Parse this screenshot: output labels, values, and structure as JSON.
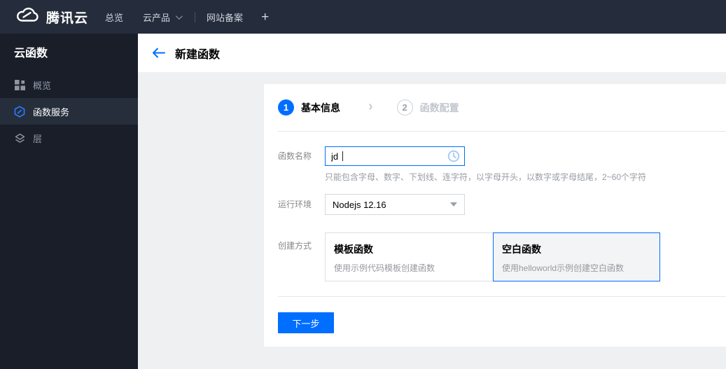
{
  "topbar": {
    "brand": "腾讯云",
    "nav": [
      {
        "label": "总览",
        "has_caret": false
      },
      {
        "label": "云产品",
        "has_caret": true
      },
      {
        "label": "网站备案",
        "has_caret": false
      }
    ],
    "plus": "+"
  },
  "sidebar": {
    "title": "云函数",
    "items": [
      {
        "label": "概览",
        "icon": "grid-icon",
        "active": false
      },
      {
        "label": "函数服务",
        "icon": "scf-hexagon-icon",
        "active": true
      },
      {
        "label": "层",
        "icon": "layers-icon",
        "active": false
      }
    ]
  },
  "header": {
    "title": "新建函数",
    "back_icon": "arrow-left-icon"
  },
  "wizard": {
    "steps": [
      {
        "number": "1",
        "label": "基本信息",
        "active": true
      },
      {
        "number": "2",
        "label": "函数配置",
        "active": false
      }
    ],
    "form": {
      "name": {
        "label": "函数名称",
        "value": "jd",
        "history_icon": "clock-icon",
        "helper": "只能包含字母、数字、下划线、连字符，以字母开头，以数字或字母结尾，2~60个字符"
      },
      "runtime": {
        "label": "运行环境",
        "value": "Nodejs 12.16"
      },
      "method": {
        "label": "创建方式",
        "options": [
          {
            "title": "模板函数",
            "desc": "使用示例代码模板创建函数",
            "selected": false
          },
          {
            "title": "空白函数",
            "desc": "使用helloworld示例创建空白函数",
            "selected": true
          }
        ]
      }
    },
    "next_button": "下一步"
  },
  "colors": {
    "accent": "#006eff",
    "topbar_bg": "#252c3b",
    "sidebar_bg": "#191e29",
    "sidebar_active_bg": "#262e3c",
    "content_bg": "#eff0f2",
    "selected_tile_bg": "#f3f4f6"
  }
}
